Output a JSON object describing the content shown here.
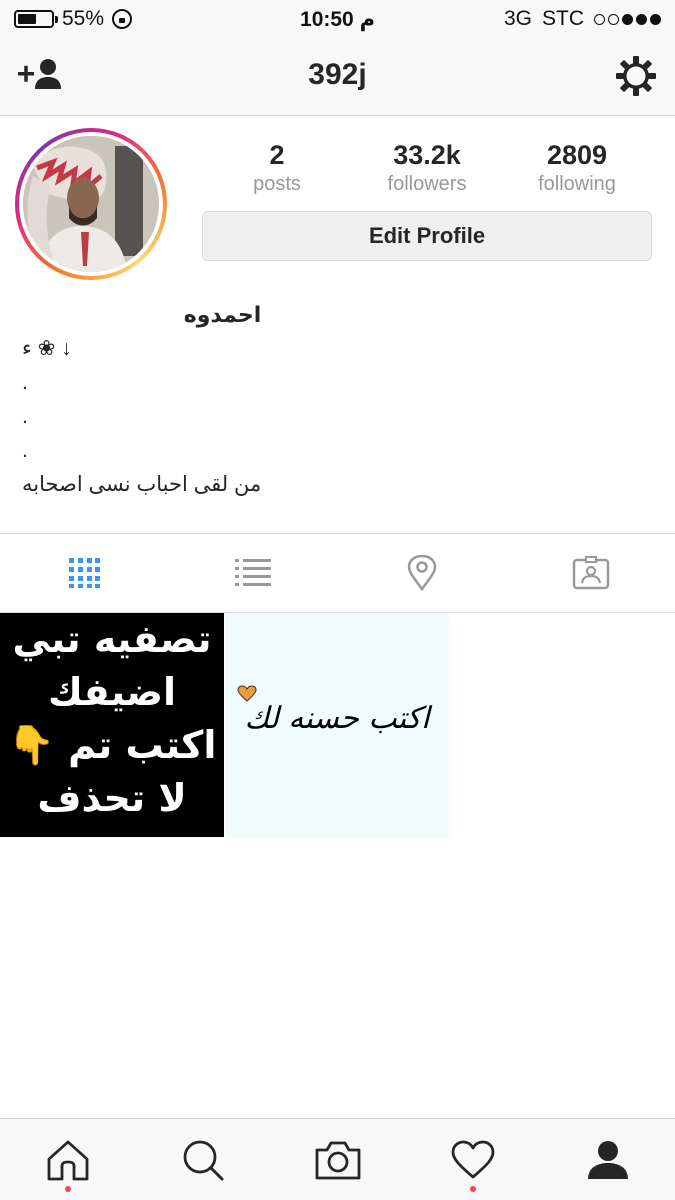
{
  "status_bar": {
    "battery_text": "55%",
    "battery_level": 0.55,
    "time": "10:50 م",
    "network": "3G",
    "carrier": "STC",
    "signal_bars_on": 3,
    "signal_bars_total": 5
  },
  "nav": {
    "username": "392j",
    "left_icon": "add-user-icon",
    "right_icon": "settings-gear-icon"
  },
  "profile": {
    "stats": [
      {
        "count": "2",
        "label": "posts"
      },
      {
        "count": "33.2k",
        "label": "followers"
      },
      {
        "count": "2809",
        "label": "following"
      }
    ],
    "edit_button": "Edit Profile",
    "display_name": "احمدوه",
    "bio_lines": [
      "↓ ❀ ء",
      ".",
      ".",
      ".",
      "من لقى احباب نسى اصحابه"
    ]
  },
  "tabs": [
    {
      "icon": "grid-icon",
      "active": true
    },
    {
      "icon": "list-icon",
      "active": false
    },
    {
      "icon": "location-pin-icon",
      "active": false
    },
    {
      "icon": "tagged-photos-icon",
      "active": false
    }
  ],
  "posts": [
    {
      "lines": [
        "تصفيه تبي",
        "اضيفك",
        "اكتب تم 👇",
        "لا تحذف"
      ]
    },
    {
      "caption": "اكتب حسنه لك"
    }
  ],
  "bottom_bar": [
    {
      "icon": "home-icon",
      "has_dot": true
    },
    {
      "icon": "search-icon",
      "has_dot": false
    },
    {
      "icon": "camera-icon",
      "has_dot": false
    },
    {
      "icon": "heart-icon",
      "has_dot": true
    },
    {
      "icon": "profile-icon",
      "has_dot": false
    }
  ],
  "colors": {
    "accent_blue": "#3897f0",
    "text_primary": "#262626",
    "text_secondary": "#999999",
    "notification_red": "#ed4956"
  }
}
